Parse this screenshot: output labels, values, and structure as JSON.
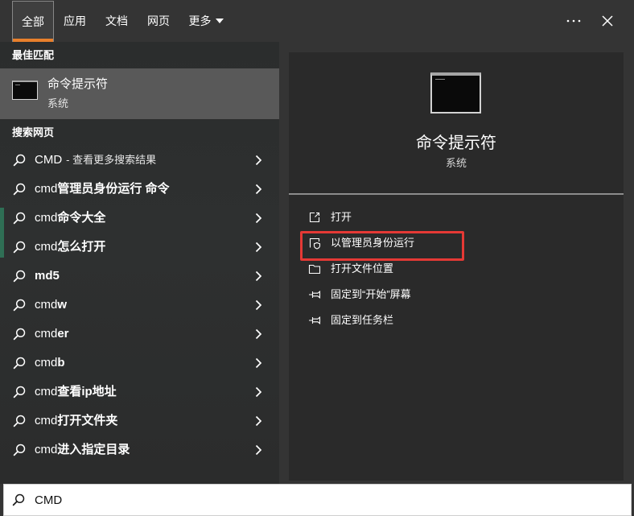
{
  "tabs": [
    {
      "label": "全部",
      "selected": true
    },
    {
      "label": "应用",
      "selected": false
    },
    {
      "label": "文档",
      "selected": false
    },
    {
      "label": "网页",
      "selected": false
    },
    {
      "label": "更多",
      "selected": false,
      "has_dropdown": true
    }
  ],
  "window_controls": {
    "more_options_icon": "more-options-icon",
    "close_icon": "close-icon"
  },
  "best_match": {
    "heading": "最佳匹配",
    "title": "命令提示符",
    "subtitle": "系统",
    "icon": "command-prompt-icon"
  },
  "web_search": {
    "heading": "搜索网页",
    "item_icon": "search-icon",
    "items": [
      {
        "plain": "CMD",
        "bold": "",
        "note": "- 查看更多搜索结果"
      },
      {
        "plain": "cmd",
        "bold": "管理员身份运行 命令"
      },
      {
        "plain": "cmd",
        "bold": "命令大全"
      },
      {
        "plain": "cmd",
        "bold": "怎么打开"
      },
      {
        "plain": "",
        "bold": "md5"
      },
      {
        "plain": "cmd",
        "bold": "w"
      },
      {
        "plain": "cmd",
        "bold": "er"
      },
      {
        "plain": "cmd",
        "bold": "b"
      },
      {
        "plain": "cmd",
        "bold": "查看ip地址"
      },
      {
        "plain": "cmd",
        "bold": "打开文件夹"
      },
      {
        "plain": "cmd",
        "bold": "进入指定目录"
      }
    ]
  },
  "detail": {
    "icon": "command-prompt-icon",
    "title": "命令提示符",
    "subtitle": "系统",
    "actions": [
      {
        "label": "打开",
        "icon": "open-icon"
      },
      {
        "label": "以管理员身份运行",
        "icon": "run-as-admin-shield-icon"
      },
      {
        "label": "打开文件位置",
        "icon": "file-location-icon"
      },
      {
        "label": "固定到“开始”屏幕",
        "icon": "pin-icon"
      },
      {
        "label": "固定到任务栏",
        "icon": "pin-icon"
      }
    ],
    "highlighted_action_index": 1
  },
  "search_box": {
    "value": "CMD",
    "icon": "search-icon"
  },
  "colors": {
    "tab_accent": "#e8802c",
    "best_match_background": "#595959",
    "annotation_highlight": "#e53935",
    "search_box_background": "#ffffff"
  }
}
